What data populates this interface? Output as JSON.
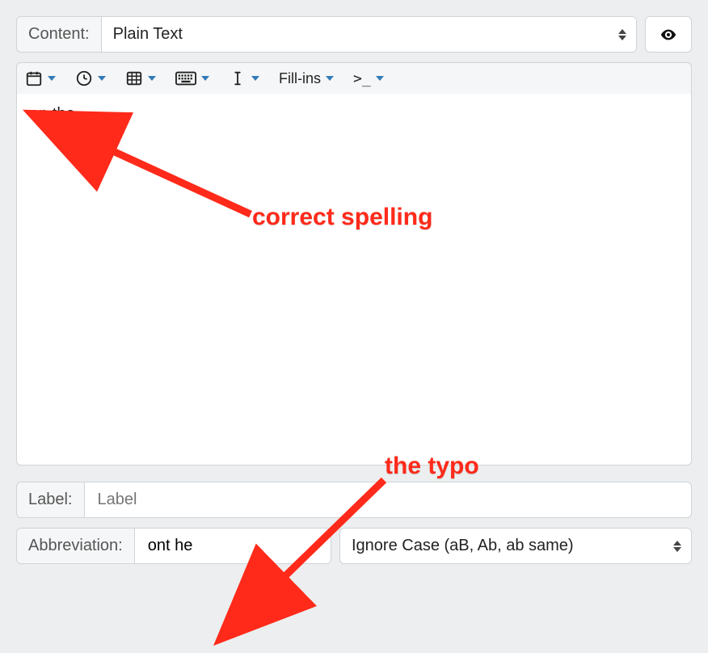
{
  "header": {
    "content_label": "Content:",
    "content_type": "Plain Text"
  },
  "toolbar": {
    "fillins_label": "Fill-ins",
    "terminal_label": ">_"
  },
  "editor": {
    "text": "on the"
  },
  "label_field": {
    "caption": "Label:",
    "placeholder": "Label"
  },
  "abbr_field": {
    "caption": "Abbreviation:",
    "value": "ont he"
  },
  "case_select": {
    "value": "Ignore Case (aB, Ab, ab same)"
  },
  "annotations": {
    "correct": "correct spelling",
    "typo": "the typo"
  }
}
